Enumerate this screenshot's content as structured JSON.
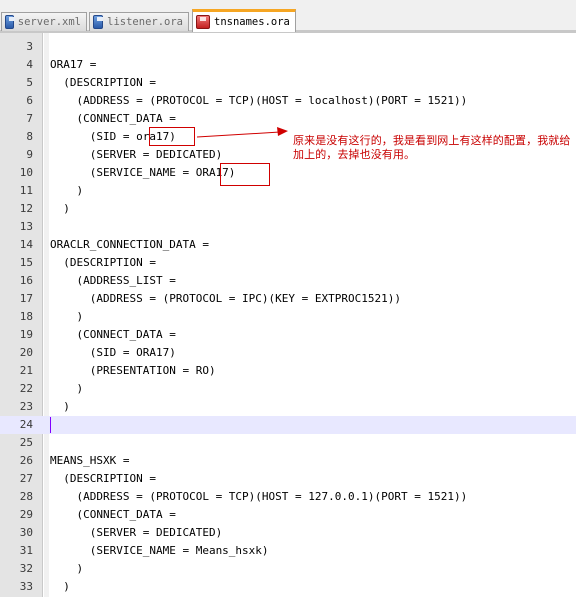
{
  "tabs": [
    {
      "label": "server.xml",
      "state": "saved",
      "active": false
    },
    {
      "label": "listener.ora",
      "state": "saved",
      "active": false
    },
    {
      "label": "tnsnames.ora",
      "state": "unsaved",
      "active": true
    }
  ],
  "editor": {
    "current_line": 24,
    "lines": [
      {
        "n": "3",
        "text": ""
      },
      {
        "n": "4",
        "text": "ORA17 ="
      },
      {
        "n": "5",
        "text": "  (DESCRIPTION ="
      },
      {
        "n": "6",
        "text": "    (ADDRESS = (PROTOCOL = TCP)(HOST = localhost)(PORT = 1521))"
      },
      {
        "n": "7",
        "text": "    (CONNECT_DATA ="
      },
      {
        "n": "8",
        "text": "      (SID = ora17)"
      },
      {
        "n": "9",
        "text": "      (SERVER = DEDICATED)"
      },
      {
        "n": "10",
        "text": "      (SERVICE_NAME = ORA17)"
      },
      {
        "n": "11",
        "text": "    )"
      },
      {
        "n": "12",
        "text": "  )"
      },
      {
        "n": "13",
        "text": ""
      },
      {
        "n": "14",
        "text": "ORACLR_CONNECTION_DATA ="
      },
      {
        "n": "15",
        "text": "  (DESCRIPTION ="
      },
      {
        "n": "16",
        "text": "    (ADDRESS_LIST ="
      },
      {
        "n": "17",
        "text": "      (ADDRESS = (PROTOCOL = IPC)(KEY = EXTPROC1521))"
      },
      {
        "n": "18",
        "text": "    )"
      },
      {
        "n": "19",
        "text": "    (CONNECT_DATA ="
      },
      {
        "n": "20",
        "text": "      (SID = ORA17)"
      },
      {
        "n": "21",
        "text": "      (PRESENTATION = RO)"
      },
      {
        "n": "22",
        "text": "    )"
      },
      {
        "n": "23",
        "text": "  )"
      },
      {
        "n": "24",
        "text": ""
      },
      {
        "n": "25",
        "text": ""
      },
      {
        "n": "26",
        "text": "MEANS_HSXK ="
      },
      {
        "n": "27",
        "text": "  (DESCRIPTION ="
      },
      {
        "n": "28",
        "text": "    (ADDRESS = (PROTOCOL = TCP)(HOST = 127.0.0.1)(PORT = 1521))"
      },
      {
        "n": "29",
        "text": "    (CONNECT_DATA ="
      },
      {
        "n": "30",
        "text": "      (SERVER = DEDICATED)"
      },
      {
        "n": "31",
        "text": "      (SERVICE_NAME = Means_hsxk)"
      },
      {
        "n": "32",
        "text": "    )"
      },
      {
        "n": "33",
        "text": "  )"
      }
    ]
  },
  "annotation": {
    "note": "原来是没有这行的，我是看到网上有这样的配置，我就给加上的，去掉也没有用。",
    "color": "#d00000"
  }
}
